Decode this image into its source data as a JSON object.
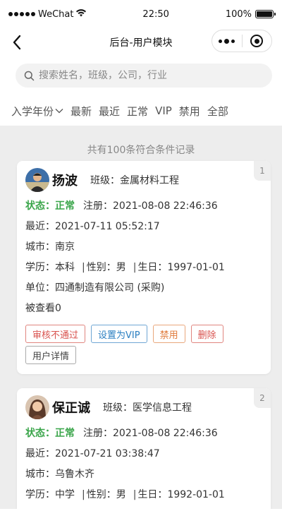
{
  "status_bar": {
    "carrier": "WeChat",
    "time": "22:50",
    "battery": "100%"
  },
  "nav": {
    "title": "后台-用户模块"
  },
  "search": {
    "placeholder": "搜索姓名，班级，公司，行业"
  },
  "filters": [
    "入学年份",
    "最新",
    "最近",
    "正常",
    "VIP",
    "禁用",
    "全部"
  ],
  "result_count": "共有100条符合条件记录",
  "labels": {
    "class": "班级：",
    "status": "状态：",
    "registered": "注册：",
    "recent": "最近：",
    "city": "城市：",
    "education": "学历：",
    "gender": "性别：",
    "birthday": "生日：",
    "company": "单位：",
    "separator": "|"
  },
  "cards": [
    {
      "index": "1",
      "name": "扬波",
      "class": "金属材料工程",
      "status": "正常",
      "registered": "2021-08-08 22:46:36",
      "recent": "2021-07-11 05:52:17",
      "city": "南京",
      "education": "本科",
      "gender": "男",
      "birthday": "1997-01-01",
      "company": "四通制造有限公司 (采购)",
      "views": "被查看0",
      "buttons": [
        "审核不通过",
        "设置为VIP",
        "禁用",
        "删除",
        "用户详情"
      ]
    },
    {
      "index": "2",
      "name": "保正诚",
      "class": "医学信息工程",
      "status": "正常",
      "registered": "2021-08-08 22:46:36",
      "recent": "2021-07-21 03:38:47",
      "city": "乌鲁木齐",
      "education": "中学",
      "gender": "男",
      "birthday": "1992-01-01"
    }
  ],
  "colors": {
    "status_green": "#3aa54a",
    "danger_red": "#d9534f",
    "vip_blue": "#2b7fc1",
    "ban_orange": "#e07a3a"
  },
  "icons": [
    "back-arrow-icon",
    "more-dots-icon",
    "target-icon",
    "search-icon",
    "chevron-down-icon",
    "wifi-icon",
    "battery-icon"
  ]
}
